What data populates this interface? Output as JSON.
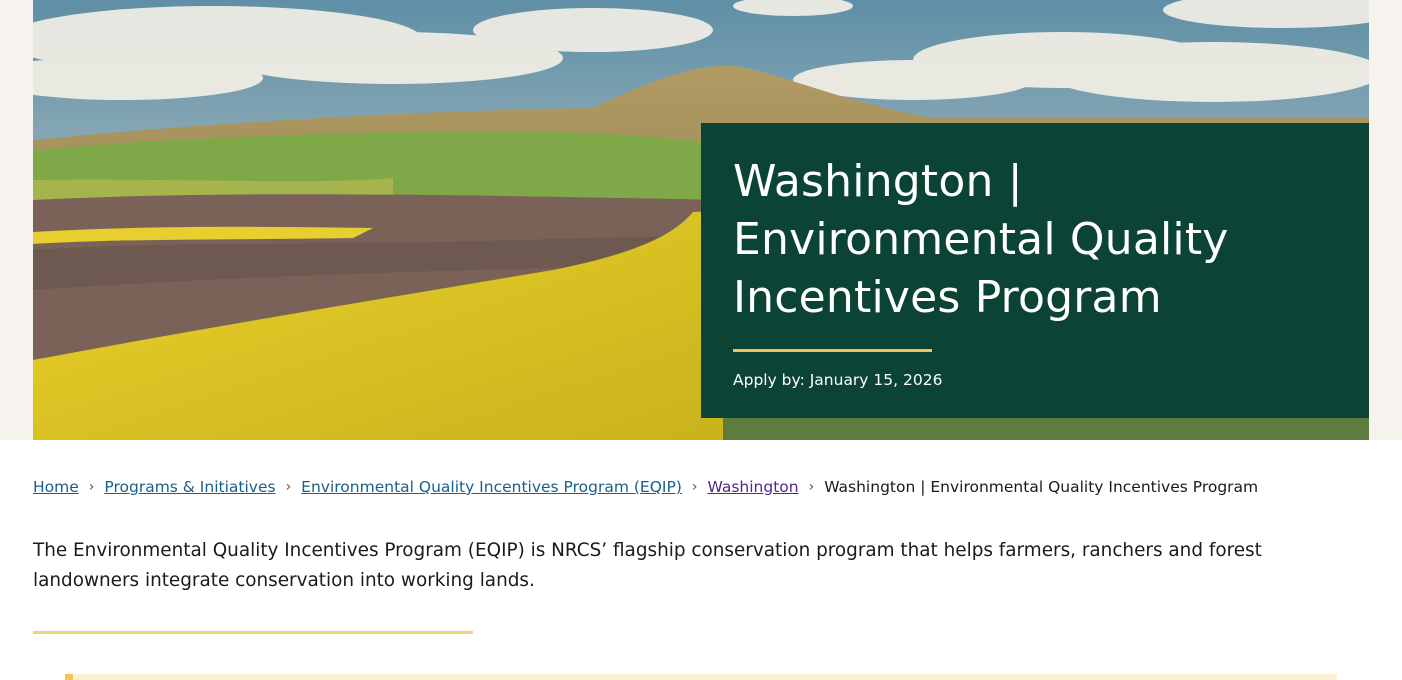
{
  "hero": {
    "image_alt": "Rolling Palouse farm fields with yellow canola and a butte under a cloudy sky",
    "title": "Washington | Environmental Quality Incentives Program",
    "apply_by": "Apply by: January 15, 2026"
  },
  "breadcrumb": {
    "items": [
      {
        "label": "Home",
        "link": true
      },
      {
        "label": "Programs & Initiatives",
        "link": true
      },
      {
        "label": "Environmental Quality Incentives Program (EQIP)",
        "link": true
      },
      {
        "label": "Washington",
        "link": true,
        "visited": true
      },
      {
        "label": "Washington | Environmental Quality Incentives Program",
        "link": false
      }
    ],
    "separator": "›"
  },
  "intro": {
    "text": "The Environmental Quality Incentives Program (EQIP) is NRCS’ flagship conservation program that helps farmers, ranchers and forest landowners integrate conservation into working lands."
  },
  "colors": {
    "card_bg": "#0b4435",
    "accent_gold": "#f2c05f",
    "link": "#1a5f8a",
    "visited_link": "#54278f"
  }
}
